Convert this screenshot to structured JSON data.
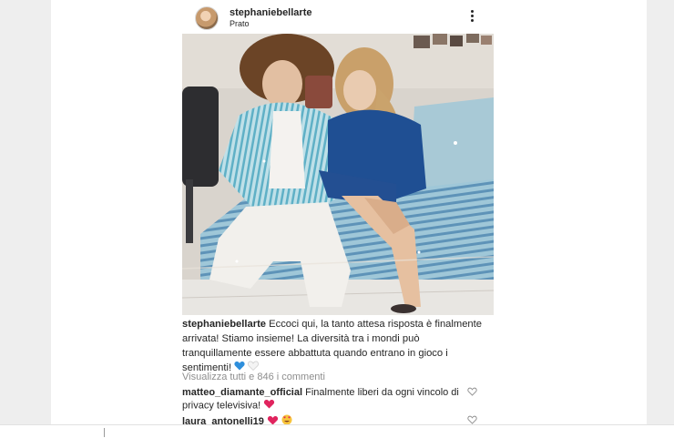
{
  "post": {
    "username": "stephaniebellarte",
    "location": "Prato",
    "caption_user": "stephaniebellarte",
    "caption_text": "Eccoci qui, la tanto attesa risposta è finalmente arrivata! Stiamo insieme! La diversità tra i mondi può tranquillamente essere abbattuta quando entrano in gioco i sentimenti!",
    "view_comments": "Visualizza tutti e 846 i commenti",
    "comments": [
      {
        "user": "matteo_diamante_official",
        "text": "Finalmente liberi da ogni vincolo di privacy televisiva!"
      },
      {
        "user": "laura_antonelli19",
        "text": ""
      }
    ]
  },
  "icons": {
    "more": "more-vertical-icon",
    "like": "heart-outline-icon",
    "emoji_blue_heart": "blue-heart-emoji",
    "emoji_white_heart": "white-heart-emoji",
    "emoji_red_heart": "red-heart-emoji",
    "emoji_heart_eyes": "heart-eyes-emoji"
  },
  "colors": {
    "username": "#262626",
    "muted": "#8e8e8e",
    "blue_heart": "#2f8fdc",
    "red_heart": "#e0245e"
  }
}
